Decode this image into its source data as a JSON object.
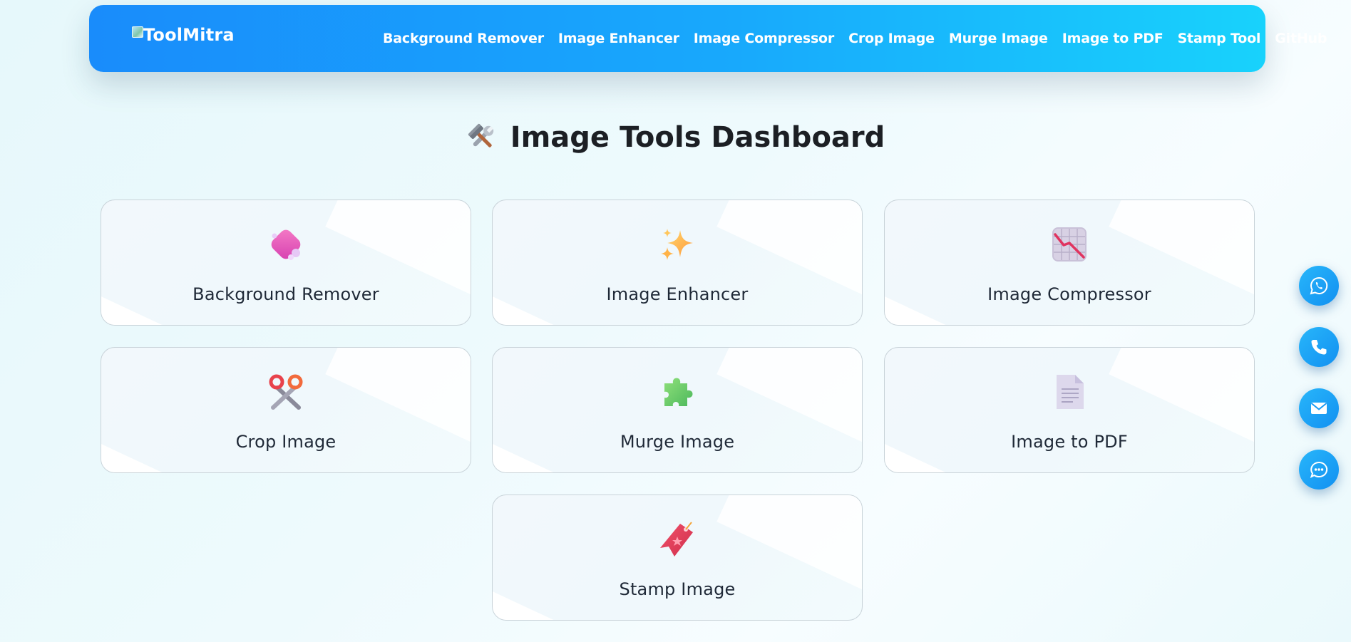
{
  "nav": {
    "logo_text": "ToolMitra",
    "links": [
      {
        "label": "Background Remover"
      },
      {
        "label": "Image Enhancer"
      },
      {
        "label": "Image Compressor"
      },
      {
        "label": "Crop Image"
      },
      {
        "label": "Murge Image"
      },
      {
        "label": "Image to PDF"
      },
      {
        "label": "Stamp Tool"
      },
      {
        "label": "GitHub"
      }
    ]
  },
  "dashboard": {
    "title": "Image Tools Dashboard",
    "title_icon": "hammer-and-wrench-icon",
    "cards": [
      {
        "label": "Background Remover",
        "icon": "eraser-icon"
      },
      {
        "label": "Image Enhancer",
        "icon": "sparkles-icon"
      },
      {
        "label": "Image Compressor",
        "icon": "chart-decreasing-icon"
      },
      {
        "label": "Crop Image",
        "icon": "scissors-icon"
      },
      {
        "label": "Murge Image",
        "icon": "puzzle-piece-icon"
      },
      {
        "label": "Image to PDF",
        "icon": "document-icon"
      },
      {
        "label": "Stamp Image",
        "icon": "bookmark-tag-icon"
      }
    ]
  },
  "floating_buttons": [
    {
      "icon": "whatsapp-icon"
    },
    {
      "icon": "phone-icon"
    },
    {
      "icon": "mail-icon"
    },
    {
      "icon": "chat-icon"
    }
  ],
  "colors": {
    "nav_gradient_start": "#198cfb",
    "nav_gradient_end": "#18d2fc",
    "float_button": "#1a9cf5",
    "title_text": "#1c1f24"
  }
}
